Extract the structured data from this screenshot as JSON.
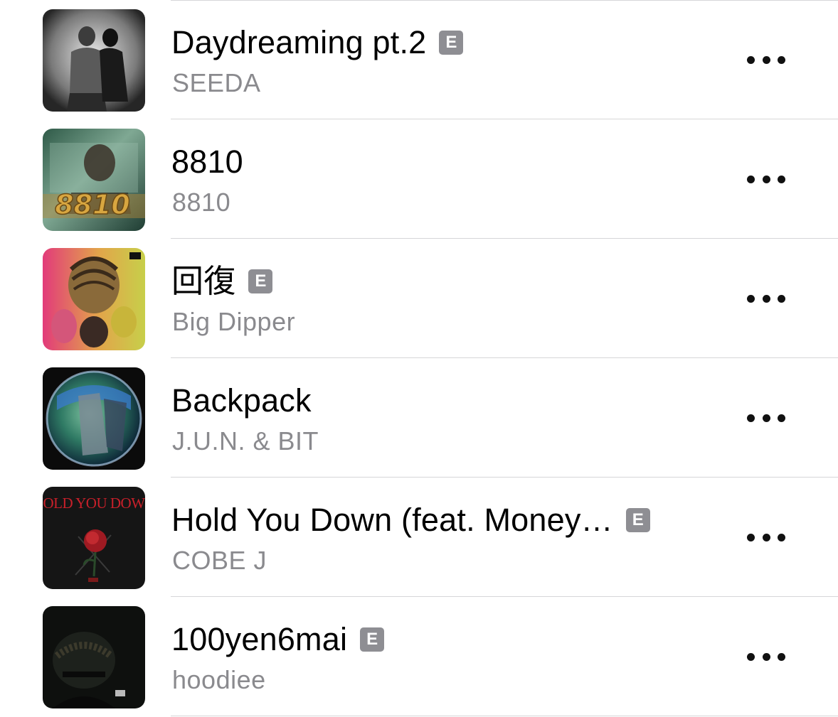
{
  "songs": [
    {
      "title": "Daydreaming pt.2",
      "artist": "SEEDA",
      "explicit": true,
      "explicit_label": "E",
      "artwork": "seeda-artwork"
    },
    {
      "title": "8810",
      "artist": "8810",
      "explicit": false,
      "artwork": "8810-artwork"
    },
    {
      "title": "回復",
      "artist": "Big Dipper",
      "explicit": true,
      "explicit_label": "E",
      "artwork": "big-dipper-artwork"
    },
    {
      "title": "Backpack",
      "artist": "J.U.N. & BIT",
      "explicit": false,
      "artwork": "backpack-artwork"
    },
    {
      "title": "Hold You Down (feat. Money…",
      "artist": "COBE J",
      "explicit": true,
      "explicit_label": "E",
      "artwork": "hold-you-down-artwork"
    },
    {
      "title": "100yen6mai",
      "artist": "hoodiee",
      "explicit": true,
      "explicit_label": "E",
      "artwork": "hoodiee-artwork"
    }
  ],
  "artwork_text": {
    "eight_ten_logo": "8810",
    "hold_you_down_logo": "HOLD YOU DOWN"
  },
  "more_icon": "ellipsis-icon"
}
